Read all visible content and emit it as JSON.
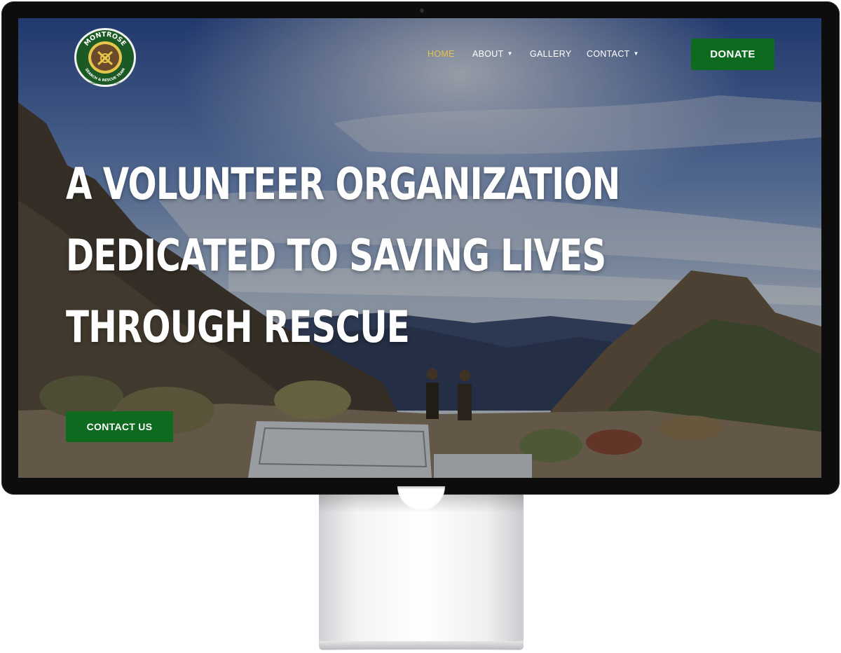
{
  "site": {
    "logo": {
      "arc_top": "MONTROSE",
      "arc_bottom": "SEARCH & RESCUE TEAM",
      "small_print": "WWW.MONTROSESRT.ORG"
    },
    "nav": [
      {
        "label": "HOME",
        "active": true,
        "dropdown": false
      },
      {
        "label": "ABOUT",
        "active": false,
        "dropdown": true
      },
      {
        "label": "GALLERY",
        "active": false,
        "dropdown": false
      },
      {
        "label": "CONTACT",
        "active": false,
        "dropdown": true
      }
    ],
    "donate_label": "DONATE",
    "hero": {
      "lines": [
        "A VOLUNTEER ORGANIZATION",
        "DEDICATED TO SAVING LIVES",
        "THROUGH RESCUE"
      ]
    },
    "contact_button_label": "CONTACT US",
    "colors": {
      "accent_green": "#0e6a1f",
      "active_nav": "#e6c64a",
      "text": "#ffffff"
    },
    "icons": {
      "dropdown": "chevron-down-icon"
    }
  }
}
